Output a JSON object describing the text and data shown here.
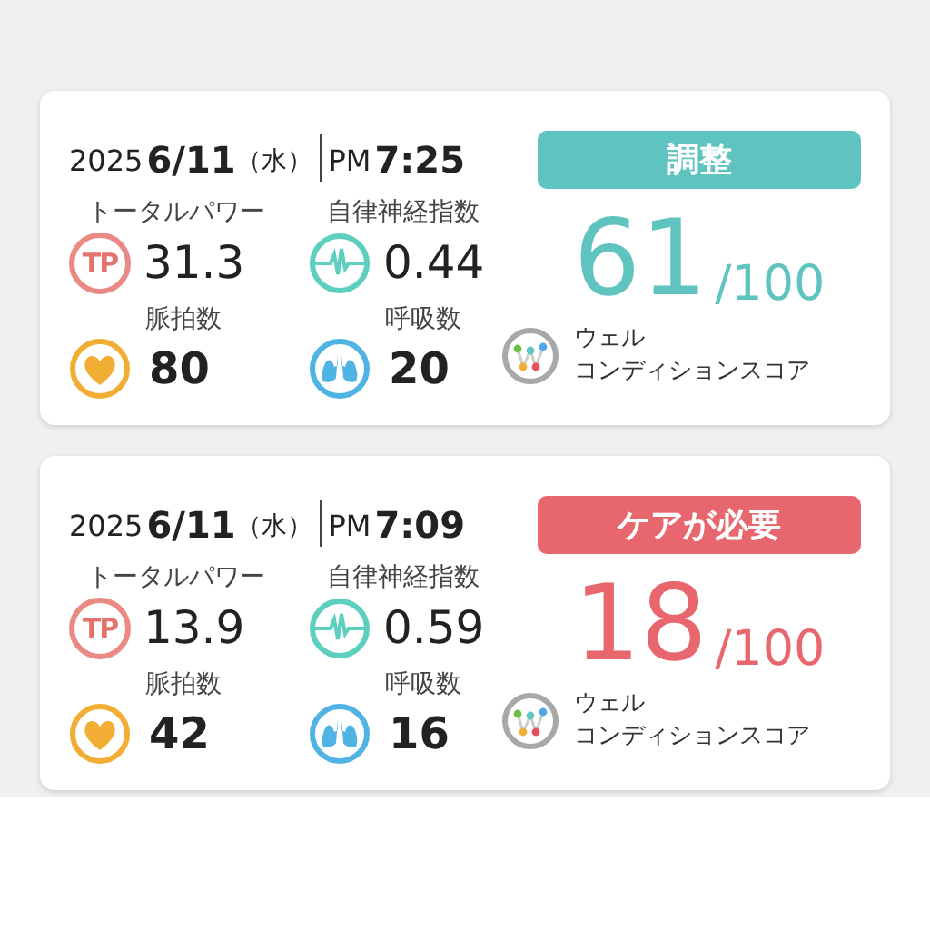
{
  "cards": [
    {
      "date": {
        "year": "2025",
        "md": "6/11",
        "dow": "（水）",
        "ampm": "PM",
        "time": "7:25"
      },
      "status": {
        "label": "調整",
        "color": "#5fc4bf"
      },
      "score": {
        "value": "61",
        "max": "/100"
      },
      "metrics": [
        {
          "kind": "tp",
          "label": "トータルパワー",
          "value": "31.3",
          "icon_text": "TP"
        },
        {
          "kind": "ans",
          "label": "自律神経指数",
          "value": "0.44"
        },
        {
          "kind": "pulse",
          "label": "脈拍数",
          "value": "80"
        },
        {
          "kind": "breath",
          "label": "呼吸数",
          "value": "20"
        }
      ],
      "wcs": [
        "ウェル",
        "コンディションスコア"
      ]
    },
    {
      "date": {
        "year": "2025",
        "md": "6/11",
        "dow": "（水）",
        "ampm": "PM",
        "time": "7:09"
      },
      "status": {
        "label": "ケアが必要",
        "color": "#e8676e"
      },
      "score": {
        "value": "18",
        "max": "/100"
      },
      "metrics": [
        {
          "kind": "tp",
          "label": "トータルパワー",
          "value": "13.9",
          "icon_text": "TP"
        },
        {
          "kind": "ans",
          "label": "自律神経指数",
          "value": "0.59"
        },
        {
          "kind": "pulse",
          "label": "脈拍数",
          "value": "42"
        },
        {
          "kind": "breath",
          "label": "呼吸数",
          "value": "16"
        }
      ],
      "wcs": [
        "ウェル",
        "コンディションスコア"
      ]
    }
  ]
}
